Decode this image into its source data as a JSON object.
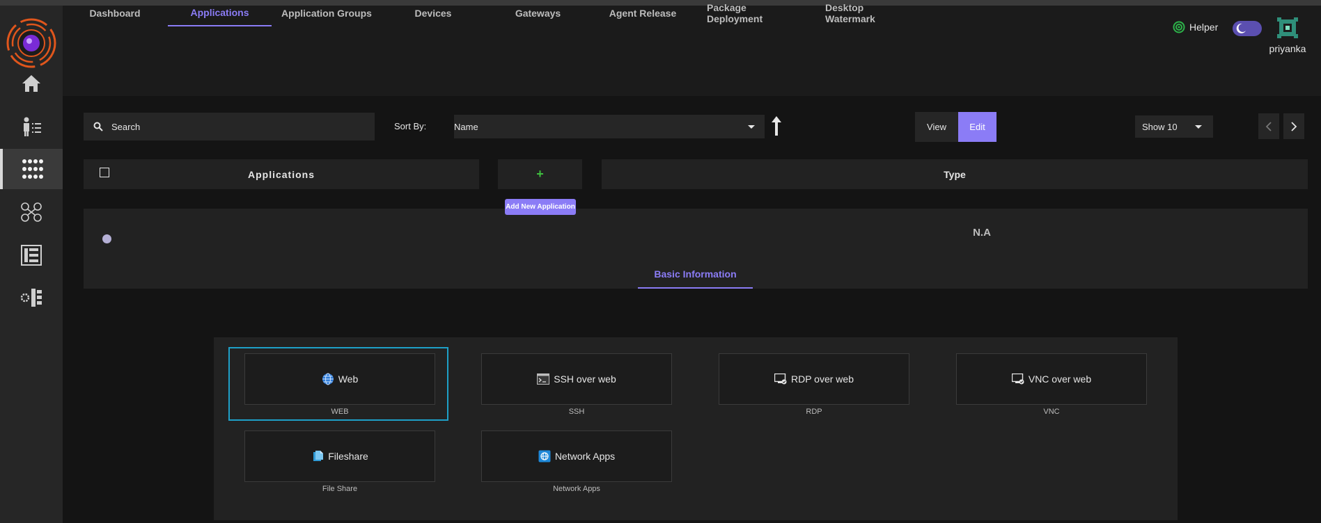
{
  "sidebar": {
    "items": [
      {
        "icon": "home-icon"
      },
      {
        "icon": "user-list-icon"
      },
      {
        "icon": "apps-grid-icon",
        "active": true
      },
      {
        "icon": "user-network-icon"
      },
      {
        "icon": "list-panel-icon"
      },
      {
        "icon": "settings-tree-icon"
      }
    ]
  },
  "header": {
    "helper_label": "Helper",
    "username": "priyanka"
  },
  "tabs": [
    {
      "label": "Dashboard"
    },
    {
      "label": "Applications",
      "active": true
    },
    {
      "label": "Application Groups"
    },
    {
      "label": "Devices"
    },
    {
      "label": "Gateways"
    },
    {
      "label": "Agent Release"
    },
    {
      "label": "Package Deployment"
    },
    {
      "label": "Desktop Watermark"
    }
  ],
  "toolbar": {
    "search_placeholder": "Search",
    "sort_label": "Sort By:",
    "sort_value": "Name",
    "view_label": "View",
    "edit_label": "Edit",
    "show_value": "Show 10"
  },
  "table": {
    "col_applications": "Applications",
    "col_add": "+",
    "add_tooltip": "Add New Application",
    "col_type": "Type",
    "row_type": "N.A",
    "row_tab": "Basic Information"
  },
  "app_types": [
    {
      "label": "Web",
      "caption": "WEB",
      "icon": "globe-icon",
      "selected": true
    },
    {
      "label": "SSH over web",
      "caption": "SSH",
      "icon": "terminal-icon"
    },
    {
      "label": "RDP over web",
      "caption": "RDP",
      "icon": "remote-desktop-icon"
    },
    {
      "label": "VNC over web",
      "caption": "VNC",
      "icon": "vnc-icon"
    },
    {
      "label": "Fileshare",
      "caption": "File Share",
      "icon": "fileshare-icon"
    },
    {
      "label": "Network Apps",
      "caption": "Network Apps",
      "icon": "network-apps-icon"
    }
  ],
  "colors": {
    "accent": "#8b7cf6",
    "selection": "#1ea0c8",
    "add_plus": "#3fbf3f",
    "helper_ring": "#2db34a"
  }
}
